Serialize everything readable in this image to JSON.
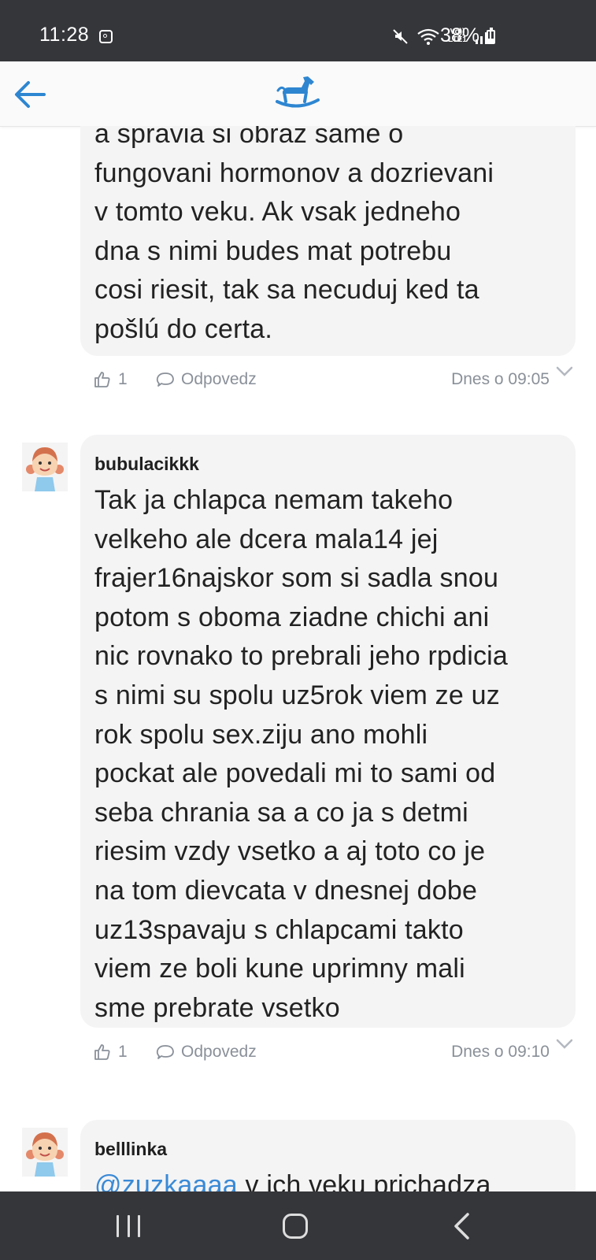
{
  "status_bar": {
    "time": "11:28",
    "network_label": "Vo)) LTE1",
    "battery_text": "38%",
    "battery_level": 0.38,
    "icons": [
      "instagram-notification-icon",
      "mute-icon",
      "wifi-icon",
      "signal-icon",
      "battery-icon"
    ]
  },
  "app_bar": {
    "back_icon": "back-arrow-icon",
    "logo_icon": "rocking-horse-logo",
    "accent_color": "#2e86d1"
  },
  "comments": [
    {
      "author": "",
      "text": "a spravia si obraz same o\nfungovani hormonov a dozrievani\nv tomto veku. Ak vsak jedneho\ndna s nimi budes mat potrebu\ncosi riesit, tak sa necuduj ked ta\npošlú do certa.",
      "likes": "1",
      "reply_label": "Odpovedz",
      "timestamp": "Dnes o 09:05"
    },
    {
      "author": "bubulacikkk",
      "text": "Tak ja chlapca nemam takeho\nvelkeho ale dcera mala14 jej\nfrajer16najskor som si sadla snou\npotom s oboma ziadne chichi ani\nnic rovnako to prebrali jeho rpdicia\ns nimi su spolu uz5rok viem ze uz\nrok spolu sex.ziju ano mohli\npockat ale povedali mi to sami od\nseba chrania sa a co ja s detmi\nriesim vzdy vsetko a aj toto co je\nna tom dievcata v dnesnej dobe\nuz13spavaju s chlapcami takto\nviem ze boli kune uprimny mali\nsme prebrate vsetko",
      "likes": "1",
      "reply_label": "Odpovedz",
      "timestamp": "Dnes o 09:10"
    },
    {
      "author": "belllinka",
      "mention": "@zuzkaaaa",
      "text": " v ich veku prichadza"
    }
  ],
  "nav_bar": {
    "icons": [
      "recent-apps-icon",
      "home-icon",
      "back-icon"
    ]
  }
}
